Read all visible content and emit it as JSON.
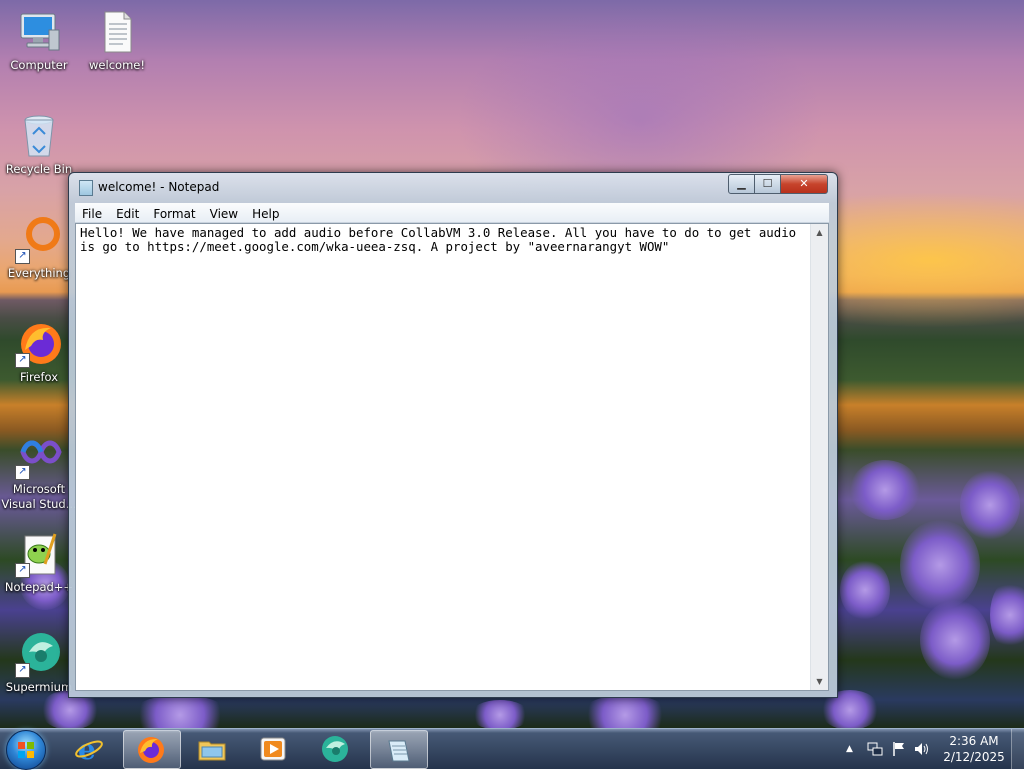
{
  "desktop": {
    "icons": [
      {
        "label": "Computer",
        "icon": "computer-icon"
      },
      {
        "label": "welcome!",
        "icon": "text-file-icon"
      },
      {
        "label": "Recycle Bin",
        "icon": "recycle-bin-icon"
      },
      {
        "label": "Everything",
        "icon": "everything-search-icon"
      },
      {
        "label": "Firefox",
        "icon": "firefox-icon"
      },
      {
        "label": "Microsoft Visual Stud...",
        "icon": "visual-studio-icon"
      },
      {
        "label": "Notepad++",
        "icon": "notepadpp-icon"
      },
      {
        "label": "Supermium",
        "icon": "supermium-icon"
      }
    ]
  },
  "notepad": {
    "title": "welcome! - Notepad",
    "menu": [
      "File",
      "Edit",
      "Format",
      "View",
      "Help"
    ],
    "content": "Hello! We have managed to add audio before CollabVM 3.0 Release. All you have to do to get audio is go to https://meet.google.com/wka-ueea-zsq. A project by \"aveernarangyt WOW\"",
    "buttons": {
      "minimize": "▁",
      "maximize": "☐",
      "close": "✕"
    }
  },
  "taskbar": {
    "start_icon": "windows-orb-icon",
    "pinned": [
      {
        "name": "internet-explorer-icon"
      },
      {
        "name": "firefox-icon"
      },
      {
        "name": "file-explorer-icon"
      },
      {
        "name": "media-player-icon"
      },
      {
        "name": "supermium-icon"
      },
      {
        "name": "notepad-icon"
      }
    ],
    "tray": {
      "show_hidden": "▲",
      "time": "2:36 AM",
      "date": "2/12/2025"
    }
  },
  "colors": {
    "taskbar": "#1e2d46",
    "close_button": "#c7442c",
    "window_frame": "#bccad9"
  }
}
